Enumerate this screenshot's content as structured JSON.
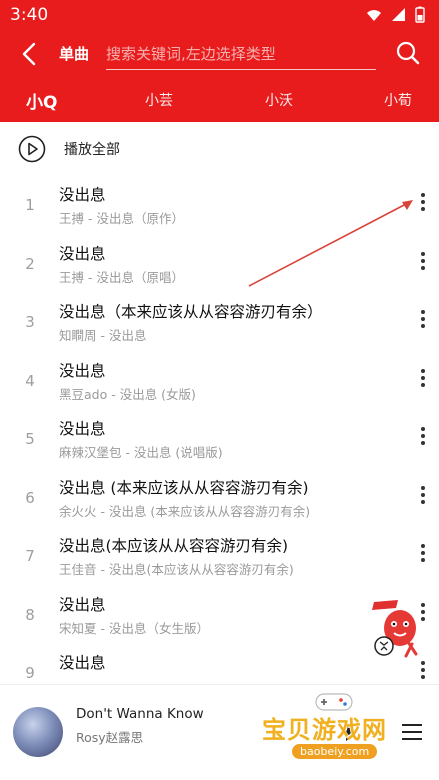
{
  "status_bar": {
    "time": "3:40"
  },
  "app_bar": {
    "back_icon": "back-arrow-icon",
    "type_label": "单曲",
    "search_placeholder": "搜索关键词,左边选择类型",
    "search_icon": "search-icon"
  },
  "tabs": [
    {
      "label": "小Q",
      "active": true
    },
    {
      "label": "小芸",
      "active": false
    },
    {
      "label": "小沃",
      "active": false
    },
    {
      "label": "小荀",
      "active": false
    }
  ],
  "play_all": {
    "label": "播放全部",
    "icon": "play-circle-icon"
  },
  "songs": [
    {
      "index": "1",
      "title": "没出息",
      "subtitle": "王搏 - 没出息（原作）"
    },
    {
      "index": "2",
      "title": "没出息",
      "subtitle": "王搏 - 没出息（原唱）"
    },
    {
      "index": "3",
      "title": "没出息（本来应该从从容容游刃有余）",
      "subtitle": "知瞷周 - 没出息"
    },
    {
      "index": "4",
      "title": "没出息",
      "subtitle": "黑豆ado - 没出息 (女版)"
    },
    {
      "index": "5",
      "title": "没出息",
      "subtitle": "麻辣汉堡包 - 没出息 (说唱版)"
    },
    {
      "index": "6",
      "title": "没出息 (本来应该从从容容游刃有余)",
      "subtitle": "余火火 - 没出息 (本来应该从从容容游刃有余)"
    },
    {
      "index": "7",
      "title": "没出息(本应该从从容容游刃有余)",
      "subtitle": "王佳音 - 没出息(本应该从从容容游刃有余)"
    },
    {
      "index": "8",
      "title": "没出息",
      "subtitle": "宋知夏 - 没出息（女生版）"
    },
    {
      "index": "9",
      "title": "没出息",
      "subtitle": ""
    }
  ],
  "player": {
    "track_title": "Don't Wanna Know",
    "track_artist": "Rosy赵露思"
  },
  "watermark": {
    "title": "宝贝游戏网",
    "url": "baobeiy.com"
  },
  "colors": {
    "accent": "#e81c1c",
    "annotation": "#d9443a"
  }
}
